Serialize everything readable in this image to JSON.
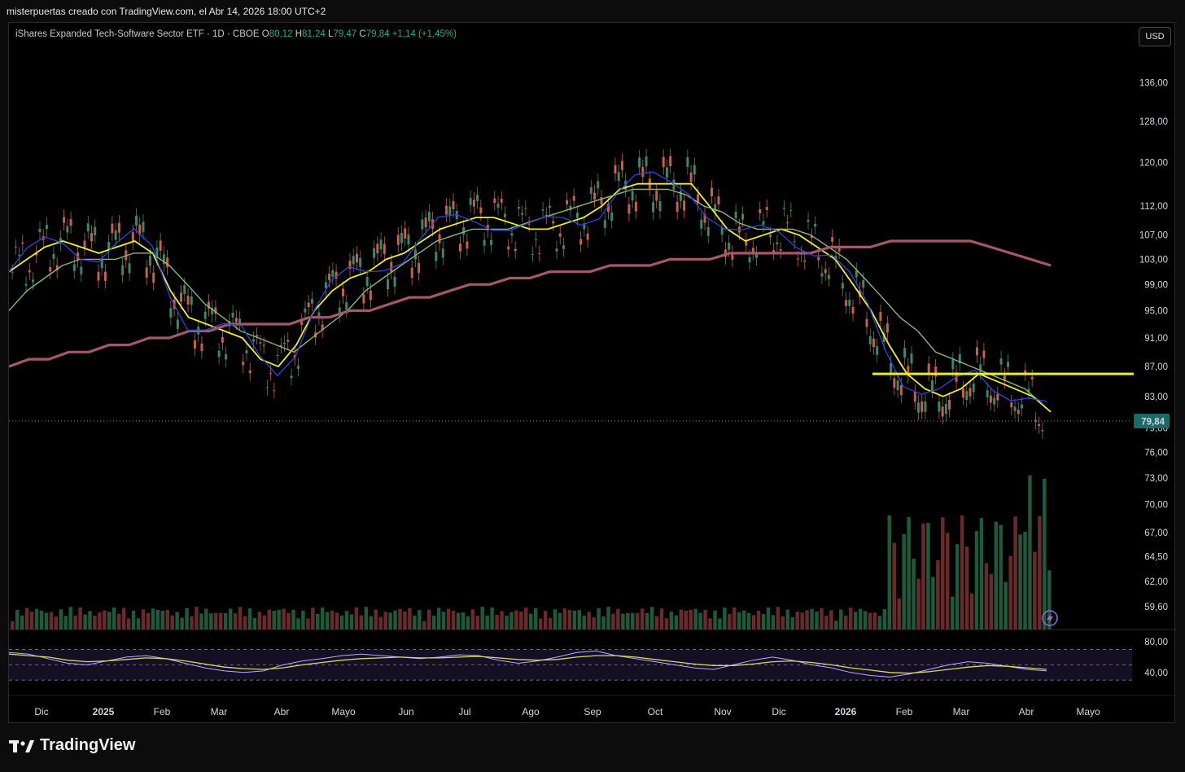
{
  "caption": "misterpuertas creado con TradingView.com, el Abr 14, 2026 18:00 UTC+2",
  "legend": {
    "name": "iShares Expanded Tech-Software Sector ETF · 1D · CBOE",
    "o_key": "O",
    "o_val": "80,12",
    "h_key": "H",
    "h_val": "81,24",
    "l_key": "L",
    "l_val": "79,47",
    "c_key": "C",
    "c_val": "79,84",
    "change": "+1,14 (+1,45%)"
  },
  "currency": "USD",
  "brand": "TradingView",
  "price_tag": "79,84",
  "chart_data": {
    "type": "line",
    "title": "iShares Expanded Tech-Software Sector ETF · 1D · CBOE",
    "y_ticks": [
      136,
      128,
      120,
      112,
      107,
      103,
      99,
      95,
      91,
      87,
      83,
      79,
      76,
      73,
      70,
      67,
      64.5,
      62,
      59.6
    ],
    "y_tick_labels": [
      "136,00",
      "128,00",
      "120,00",
      "112,00",
      "107,00",
      "103,00",
      "99,00",
      "95,00",
      "91,00",
      "87,00",
      "83,00",
      "79,00",
      "76,00",
      "73,00",
      "70,00",
      "67,00",
      "64,50",
      "62,00",
      "59,60"
    ],
    "y_scale": "log",
    "x_months": [
      "Dic",
      "2025",
      "Feb",
      "Mar",
      "Abr",
      "Mayo",
      "Jun",
      "Jul",
      "Ago",
      "Sep",
      "Oct",
      "Nov",
      "Dic",
      "2026",
      "Feb",
      "Mar",
      "Abr",
      "Mayo"
    ],
    "last_price": 79.84,
    "horizontal_level": 86,
    "series": [
      {
        "name": "",
        "color": "#eeee22",
        "values": [
          101,
          103,
          105,
          106,
          105,
          104,
          105,
          106,
          104,
          98,
          94,
          93,
          92,
          91,
          88,
          87,
          90,
          95,
          98,
          100,
          101,
          103,
          104,
          106,
          108,
          109,
          110,
          110,
          109,
          108,
          108,
          109,
          110,
          112,
          115,
          116,
          116,
          116,
          116,
          112,
          108,
          106,
          107,
          108,
          107,
          105,
          103,
          99,
          95,
          90,
          86,
          84,
          83,
          84,
          86,
          85,
          84,
          83,
          81
        ]
      },
      {
        "name": "",
        "color": "#8bb86e",
        "values": [
          95,
          98,
          100,
          102,
          103,
          103,
          103,
          104,
          104,
          102,
          99,
          96,
          94,
          92,
          91,
          90,
          89,
          91,
          93,
          95,
          98,
          100,
          102,
          104,
          106,
          107,
          108,
          108,
          108,
          109,
          110,
          111,
          112,
          113,
          114,
          115,
          115,
          115,
          114,
          112,
          111,
          109,
          108,
          108,
          108,
          107,
          105,
          103,
          100,
          97,
          94,
          92,
          89,
          88,
          87,
          86,
          85,
          84,
          82
        ]
      },
      {
        "name": "",
        "color": "#a45868",
        "values": [
          87,
          88,
          88,
          89,
          89,
          90,
          90,
          91,
          91,
          92,
          92,
          93,
          93,
          93,
          93,
          94,
          94,
          95,
          95,
          96,
          97,
          97,
          98,
          99,
          99,
          100,
          100,
          101,
          101,
          101,
          102,
          102,
          102,
          103,
          103,
          103,
          104,
          104,
          104,
          104,
          104,
          105,
          105,
          105,
          106,
          106,
          106,
          106,
          106,
          105,
          104,
          103,
          102
        ]
      },
      {
        "name": "",
        "color": "#b9a9ff",
        "values": [
          66,
          64,
          58,
          52,
          50,
          55,
          60,
          62,
          58,
          52,
          46,
          42,
          40,
          42,
          50,
          55,
          58,
          62,
          64,
          62,
          60,
          58,
          60,
          63,
          62,
          56,
          52,
          55,
          60,
          66,
          68,
          62,
          58,
          54,
          50,
          46,
          44,
          50,
          56,
          60,
          56,
          50,
          46,
          40,
          36,
          34,
          38,
          44,
          50,
          54,
          52,
          48,
          44,
          42
        ]
      },
      {
        "name": "",
        "color": "#d8d860",
        "values": [
          64,
          62,
          60,
          56,
          54,
          55,
          57,
          59,
          58,
          55,
          51,
          47,
          45,
          44,
          46,
          50,
          53,
          56,
          58,
          59,
          60,
          59,
          59,
          60,
          61,
          59,
          57,
          56,
          57,
          60,
          62,
          62,
          60,
          57,
          54,
          51,
          49,
          49,
          51,
          54,
          55,
          53,
          50,
          46,
          43,
          40,
          39,
          41,
          44,
          47,
          49,
          48,
          46,
          44
        ]
      }
    ],
    "rsi_ticks": [
      80,
      40
    ],
    "rsi_tick_labels": [
      "80,00",
      "40,00"
    ]
  }
}
